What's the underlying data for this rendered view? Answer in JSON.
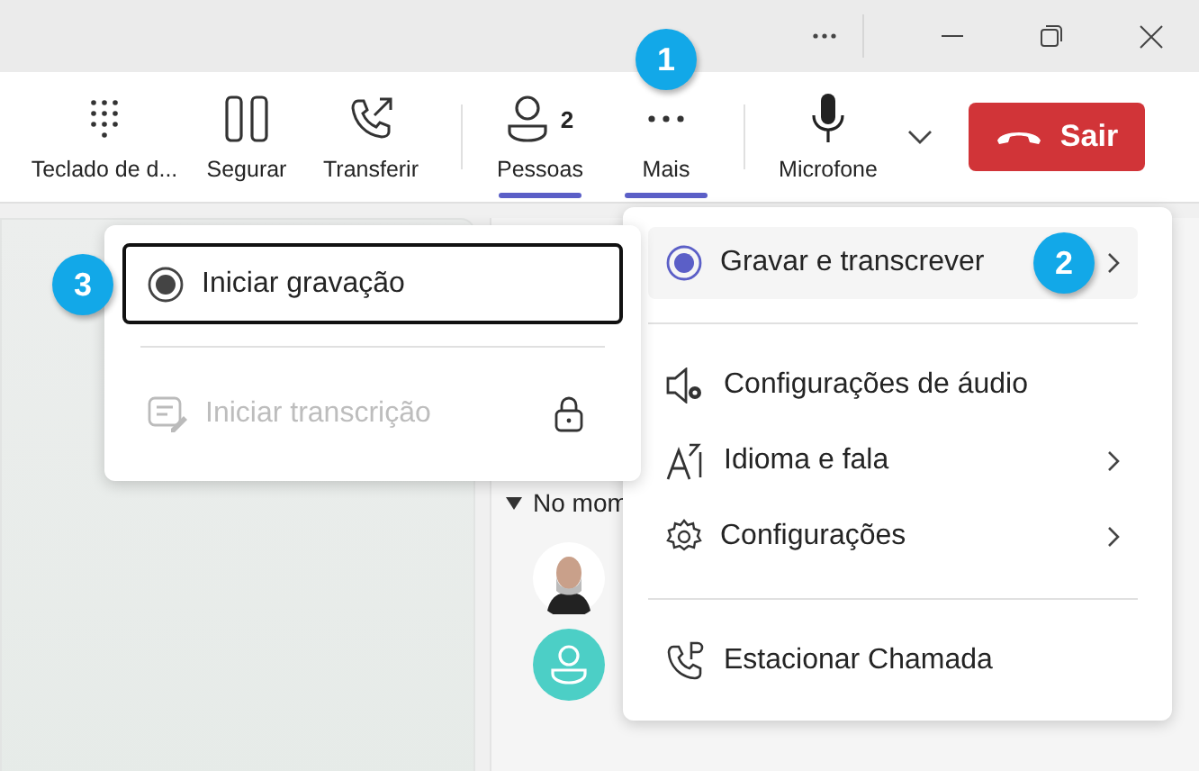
{
  "toolbar": {
    "buttons": [
      {
        "kind": "dialpad",
        "label": "Teclado de d...",
        "selected": false
      },
      {
        "kind": "hold",
        "label": "Segurar",
        "selected": false
      },
      {
        "kind": "transfer",
        "label": "Transferir",
        "selected": false
      },
      {
        "kind": "people",
        "label": "Pessoas",
        "count": "2",
        "selected": true
      },
      {
        "kind": "more",
        "label": "Mais",
        "selected": true,
        "callout": "1"
      }
    ],
    "microphone": {
      "label": "Microfone"
    },
    "leave_button": {
      "label": "Sair"
    }
  },
  "participants_panel": {
    "section": "No mom",
    "participants": [
      {
        "kind": "photo"
      },
      {
        "kind": "generic"
      }
    ]
  },
  "more_menu": {
    "groups": [
      [
        {
          "kind": "record",
          "label": "Gravar e transcrever",
          "submenu": true,
          "selected": true,
          "callout": "2"
        }
      ],
      [
        {
          "kind": "audio",
          "label": "Configurações de áudio",
          "submenu": false,
          "selected": false
        },
        {
          "kind": "language",
          "label": "Idioma e fala",
          "submenu": true,
          "selected": false
        },
        {
          "kind": "settings",
          "label": "Configurações",
          "submenu": true,
          "selected": false
        }
      ],
      [
        {
          "kind": "park",
          "label": "Estacionar Chamada",
          "submenu": false,
          "selected": false
        }
      ]
    ]
  },
  "record_submenu": {
    "items": [
      {
        "kind": "record",
        "label": "Iniciar gravação",
        "focused": true,
        "disabled": false,
        "locked": false,
        "callout": "3"
      },
      {
        "kind": "transcript",
        "label": "Iniciar transcrição",
        "focused": false,
        "disabled": true,
        "locked": true
      }
    ]
  }
}
